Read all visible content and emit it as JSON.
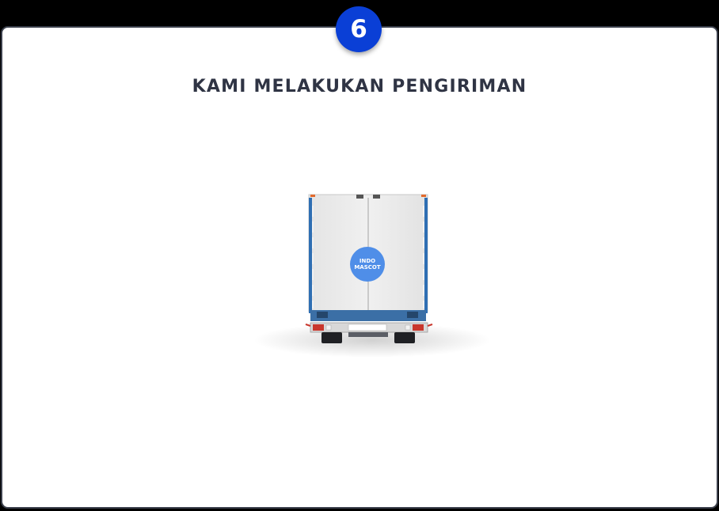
{
  "step": {
    "number": "6"
  },
  "heading": {
    "title": "KAMI MELAKUKAN PENGIRIMAN"
  },
  "illustration": {
    "logo_line1": "INDO",
    "logo_line2": "MASCOT"
  },
  "colors": {
    "badge": "#0a3fd6",
    "title_text": "#2f3444",
    "card_border": "#3a3f4b",
    "truck_body": "#ececec",
    "truck_frame": "#2f6fb3",
    "logo_circle": "#4f8ee8"
  }
}
